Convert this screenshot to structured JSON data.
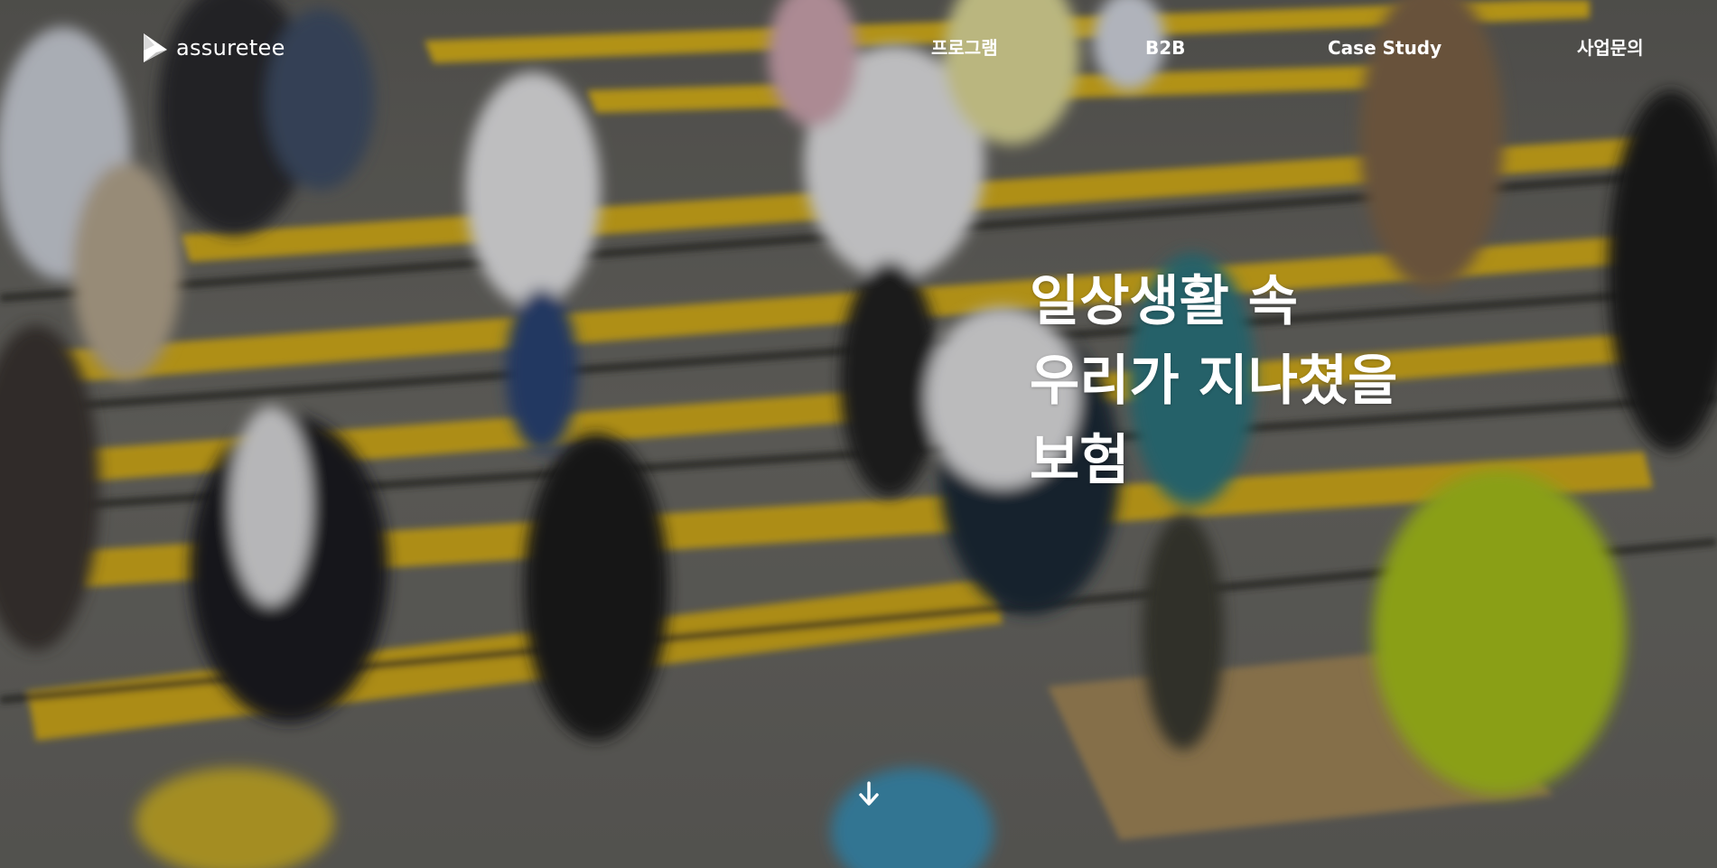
{
  "brand": {
    "name": "assuretee",
    "logo_icon": "assuretee-logo-mark"
  },
  "nav": {
    "items": [
      {
        "label": "프로그램"
      },
      {
        "label": "B2B"
      },
      {
        "label": "Case Study"
      },
      {
        "label": "사업문의"
      }
    ]
  },
  "hero": {
    "headline_lines": [
      "일상생활 속",
      "우리가 지나쳤을",
      "보험"
    ],
    "background_image": "blurred-pedestrians-crosswalk-photo",
    "scroll_icon": "arrow-down-icon"
  },
  "colors": {
    "text": "#ffffff",
    "stripe_yellow": "#e2bb22",
    "pavement": "#6e6d68"
  }
}
